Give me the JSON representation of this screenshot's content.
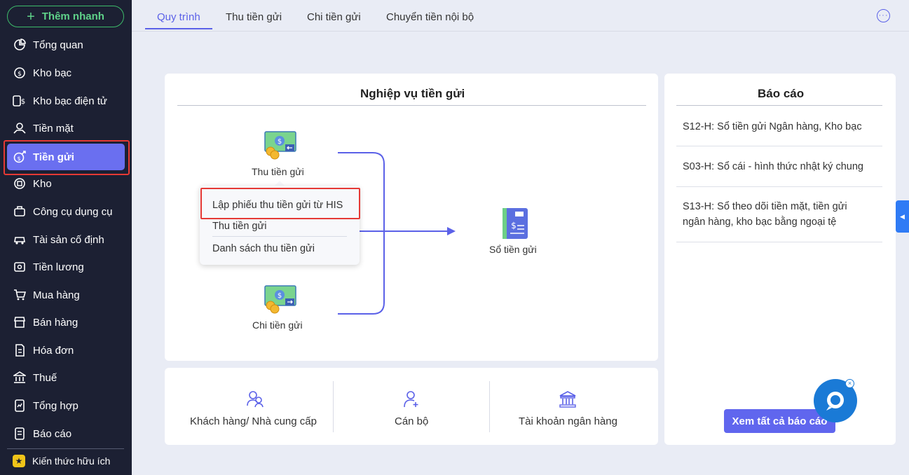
{
  "sidebar": {
    "quick_add": "Thêm nhanh",
    "items": [
      {
        "label": "Tổng quan",
        "icon": "pie-chart-icon"
      },
      {
        "label": "Kho bạc",
        "icon": "coin-icon"
      },
      {
        "label": "Kho bạc điện tử",
        "icon": "card-dollar-icon"
      },
      {
        "label": "Tiền mặt",
        "icon": "cash-hand-icon"
      },
      {
        "label": "Tiền gửi",
        "icon": "deposit-icon"
      },
      {
        "label": "Kho",
        "icon": "warehouse-icon"
      },
      {
        "label": "Công cụ dụng cụ",
        "icon": "tools-icon"
      },
      {
        "label": "Tài sản cố định",
        "icon": "car-icon"
      },
      {
        "label": "Tiền lương",
        "icon": "salary-icon"
      },
      {
        "label": "Mua hàng",
        "icon": "cart-icon"
      },
      {
        "label": "Bán hàng",
        "icon": "store-icon"
      },
      {
        "label": "Hóa đơn",
        "icon": "invoice-icon"
      },
      {
        "label": "Thuế",
        "icon": "bank-icon"
      },
      {
        "label": "Tổng hợp",
        "icon": "summary-icon"
      },
      {
        "label": "Báo cáo",
        "icon": "report-icon"
      }
    ],
    "active_index": 4,
    "extra": "Kiến thức hữu ích"
  },
  "tabs": [
    "Quy trình",
    "Thu tiền gửi",
    "Chi tiền gửi",
    "Chuyển tiền nội bộ"
  ],
  "workflow": {
    "title": "Nghiệp vụ tiền gửi",
    "receive_label": "Thu tiền gửi",
    "pay_label": "Chi tiền gửi",
    "ledger_label": "Sổ tiền gửi",
    "popup": {
      "items": [
        "Lập phiếu thu tiền gửi từ HIS",
        "Thu tiền gửi",
        "Danh sách thu tiền gửi"
      ]
    }
  },
  "reports": {
    "title": "Báo cáo",
    "items": [
      "S12-H: Sổ tiền gửi Ngân hàng, Kho bạc",
      "S03-H: Sổ cái - hình thức nhật ký chung",
      "S13-H: Sổ theo dõi tiền mặt, tiền gửi",
      "ngân hàng, kho bạc bằng ngoại tệ"
    ],
    "view_all": "Xem tất cả báo cáo"
  },
  "bottom": [
    {
      "label": "Khách hàng/ Nhà cung cấp",
      "icon": "users-icon"
    },
    {
      "label": "Cán bộ",
      "icon": "user-add-icon"
    },
    {
      "label": "Tài khoản ngân hàng",
      "icon": "bank-icon"
    }
  ],
  "colors": {
    "sidebar": "#1c2033",
    "accent": "#6066ee",
    "highlight": "#e53935",
    "green": "#3dbb6a"
  }
}
